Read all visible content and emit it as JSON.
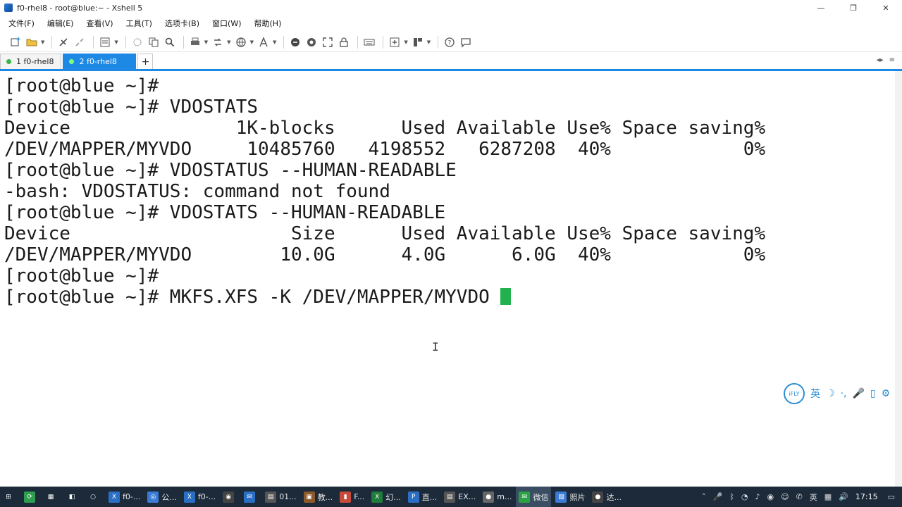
{
  "window": {
    "title": "f0-rhel8 - root@blue:~ - Xshell 5",
    "controls": [
      "—",
      "❐",
      "✕"
    ]
  },
  "menu": [
    "文件(F)",
    "编辑(E)",
    "查看(V)",
    "工具(T)",
    "选项卡(B)",
    "窗口(W)",
    "帮助(H)"
  ],
  "tabs": [
    {
      "label": "1 f0-rhel8",
      "active": false
    },
    {
      "label": "2 f0-rhel8",
      "active": true
    }
  ],
  "tab_add": "+",
  "tab_nav": [
    "◂▸",
    "≡"
  ],
  "terminal": {
    "lines": [
      "[root@blue ~]#",
      "[root@blue ~]# VDOSTATS",
      "Device               1K-blocks      Used Available Use% Space saving%",
      "/DEV/MAPPER/MYVDO     10485760   4198552   6287208  40%            0%",
      "[root@blue ~]# VDOSTATUS --HUMAN-READABLE",
      "-bash: VDOSTATUS: command not found",
      "[root@blue ~]# VDOSTATS --HUMAN-READABLE",
      "Device                    Size      Used Available Use% Space saving%",
      "/DEV/MAPPER/MYVDO        10.0G      4.0G      6.0G  40%            0%",
      "[root@blue ~]#"
    ],
    "prompt_line": "[root@blue ~]# MKFS.XFS -K /DEV/MAPPER/MYVDO "
  },
  "ime": {
    "logo": "iFLY",
    "lang": "英",
    "icons": [
      "☽",
      "·,",
      "🎤",
      "▯",
      "⚙"
    ]
  },
  "taskbar": {
    "items": [
      {
        "label": "",
        "icon": "⊞",
        "color": "#1c2a3a"
      },
      {
        "label": "",
        "icon": "⟳",
        "color": "#2e9d4f"
      },
      {
        "label": "",
        "icon": "▦",
        "color": "#1c2a3a"
      },
      {
        "label": "",
        "icon": "◧",
        "color": "#1c2a3a"
      },
      {
        "label": "",
        "icon": "○",
        "color": "#1c2a3a"
      },
      {
        "label": "f0-...",
        "icon": "X",
        "color": "#2a6fc4"
      },
      {
        "label": "公...",
        "icon": "◎",
        "color": "#3a7bd5"
      },
      {
        "label": "f0-...",
        "icon": "X",
        "color": "#2a6fc4"
      },
      {
        "label": "",
        "icon": "◉",
        "color": "#444"
      },
      {
        "label": "",
        "icon": "✉",
        "color": "#2a6fc4"
      },
      {
        "label": "01...",
        "icon": "▤",
        "color": "#555"
      },
      {
        "label": "教...",
        "icon": "▣",
        "color": "#8c5a2a"
      },
      {
        "label": "F...",
        "icon": "▮",
        "color": "#c84a3a"
      },
      {
        "label": "幻...",
        "icon": "X",
        "color": "#1e7d3a"
      },
      {
        "label": "直...",
        "icon": "P",
        "color": "#2a6fc4"
      },
      {
        "label": "EX...",
        "icon": "▤",
        "color": "#555"
      },
      {
        "label": "m...",
        "icon": "●",
        "color": "#666"
      },
      {
        "label": "微信",
        "icon": "✉",
        "color": "#2ba245"
      },
      {
        "label": "照片",
        "icon": "▧",
        "color": "#3a7bd5"
      },
      {
        "label": "达...",
        "icon": "●",
        "color": "#444"
      }
    ],
    "tray": [
      "˄",
      "🎤",
      "ᛒ",
      "◔",
      "♪",
      "◉",
      "☺",
      "✆",
      "英",
      "▦",
      "🔊"
    ],
    "clock": "17:15",
    "notify": "▭"
  }
}
